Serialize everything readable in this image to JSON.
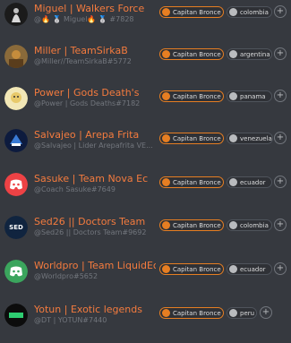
{
  "colors": {
    "background": "#36393f",
    "name_color": "#f47b3e",
    "role_color": "#e67e22",
    "handle_color": "#72767d"
  },
  "members": [
    {
      "name": "Miguel | Walkers Force",
      "handle": "@🔥 🥈 Miguel🔥 🥈 #7828",
      "role": "Capitan Bronce",
      "country": "colombia",
      "avatar": "fire-figure-avatar"
    },
    {
      "name": "Miller | TeamSirkaB",
      "handle": "@Miller//TeamSirkaB#5772",
      "role": "Capitan Bronce",
      "country": "argentina",
      "avatar": "beach-photo-avatar"
    },
    {
      "name": "Power | Gods Death's",
      "handle": "@Power | Gods Deaths#7182",
      "role": "Capitan Bronce",
      "country": "panama",
      "avatar": "cartoon-avatar"
    },
    {
      "name": "Salvajeo | Arepa Frita",
      "handle": "@Salvajeo | Lider Arepafrita VE...",
      "role": "Capitan Bronce",
      "country": "venezuela",
      "avatar": "blue-logo-avatar"
    },
    {
      "name": "Sasuke | Team Nova Ec",
      "handle": "@Coach Sasuke#7649",
      "role": "Capitan Bronce",
      "country": "ecuador",
      "avatar": "discord-default-avatar"
    },
    {
      "name": "Sed26 || Doctors Team",
      "handle": "@Sed26 || Doctors Team#9692",
      "role": "Capitan Bronce",
      "country": "colombia",
      "avatar": "sed-logo-avatar"
    },
    {
      "name": "Worldpro | Team LiquidEc",
      "handle": "@Worldpro#5652",
      "role": "Capitan Bronce",
      "country": "ecuador",
      "avatar": "discord-default-avatar"
    },
    {
      "name": "Yotun | Exotic legends",
      "handle": "@DT | YOTUN#7440",
      "role": "Capitan Bronce",
      "country": "peru",
      "avatar": "dark-logo-avatar"
    }
  ]
}
